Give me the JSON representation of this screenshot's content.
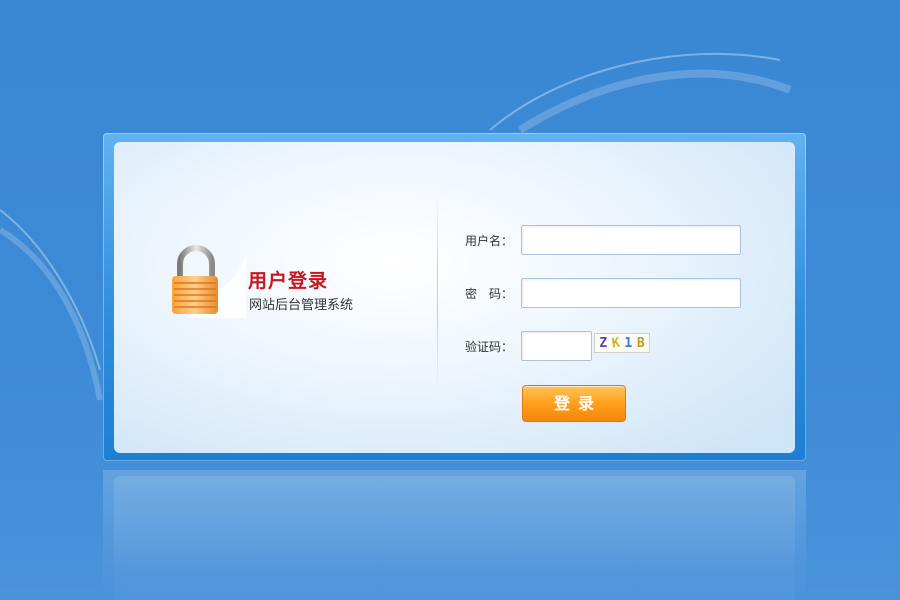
{
  "login": {
    "title": "用户登录",
    "subtitle": "网站后台管理系统",
    "fields": {
      "username_label": "用户名：",
      "username_value": "",
      "password_label": "密　码：",
      "password_value": "",
      "captcha_label": "验证码：",
      "captcha_value": ""
    },
    "captcha_chars": [
      "Z",
      "K",
      "1",
      "B"
    ],
    "submit_label": "登录"
  },
  "icons": {
    "lock": "padlock-icon"
  },
  "colors": {
    "background": "#3a87d4",
    "title": "#c8161d",
    "button": "#ff9f1c"
  }
}
